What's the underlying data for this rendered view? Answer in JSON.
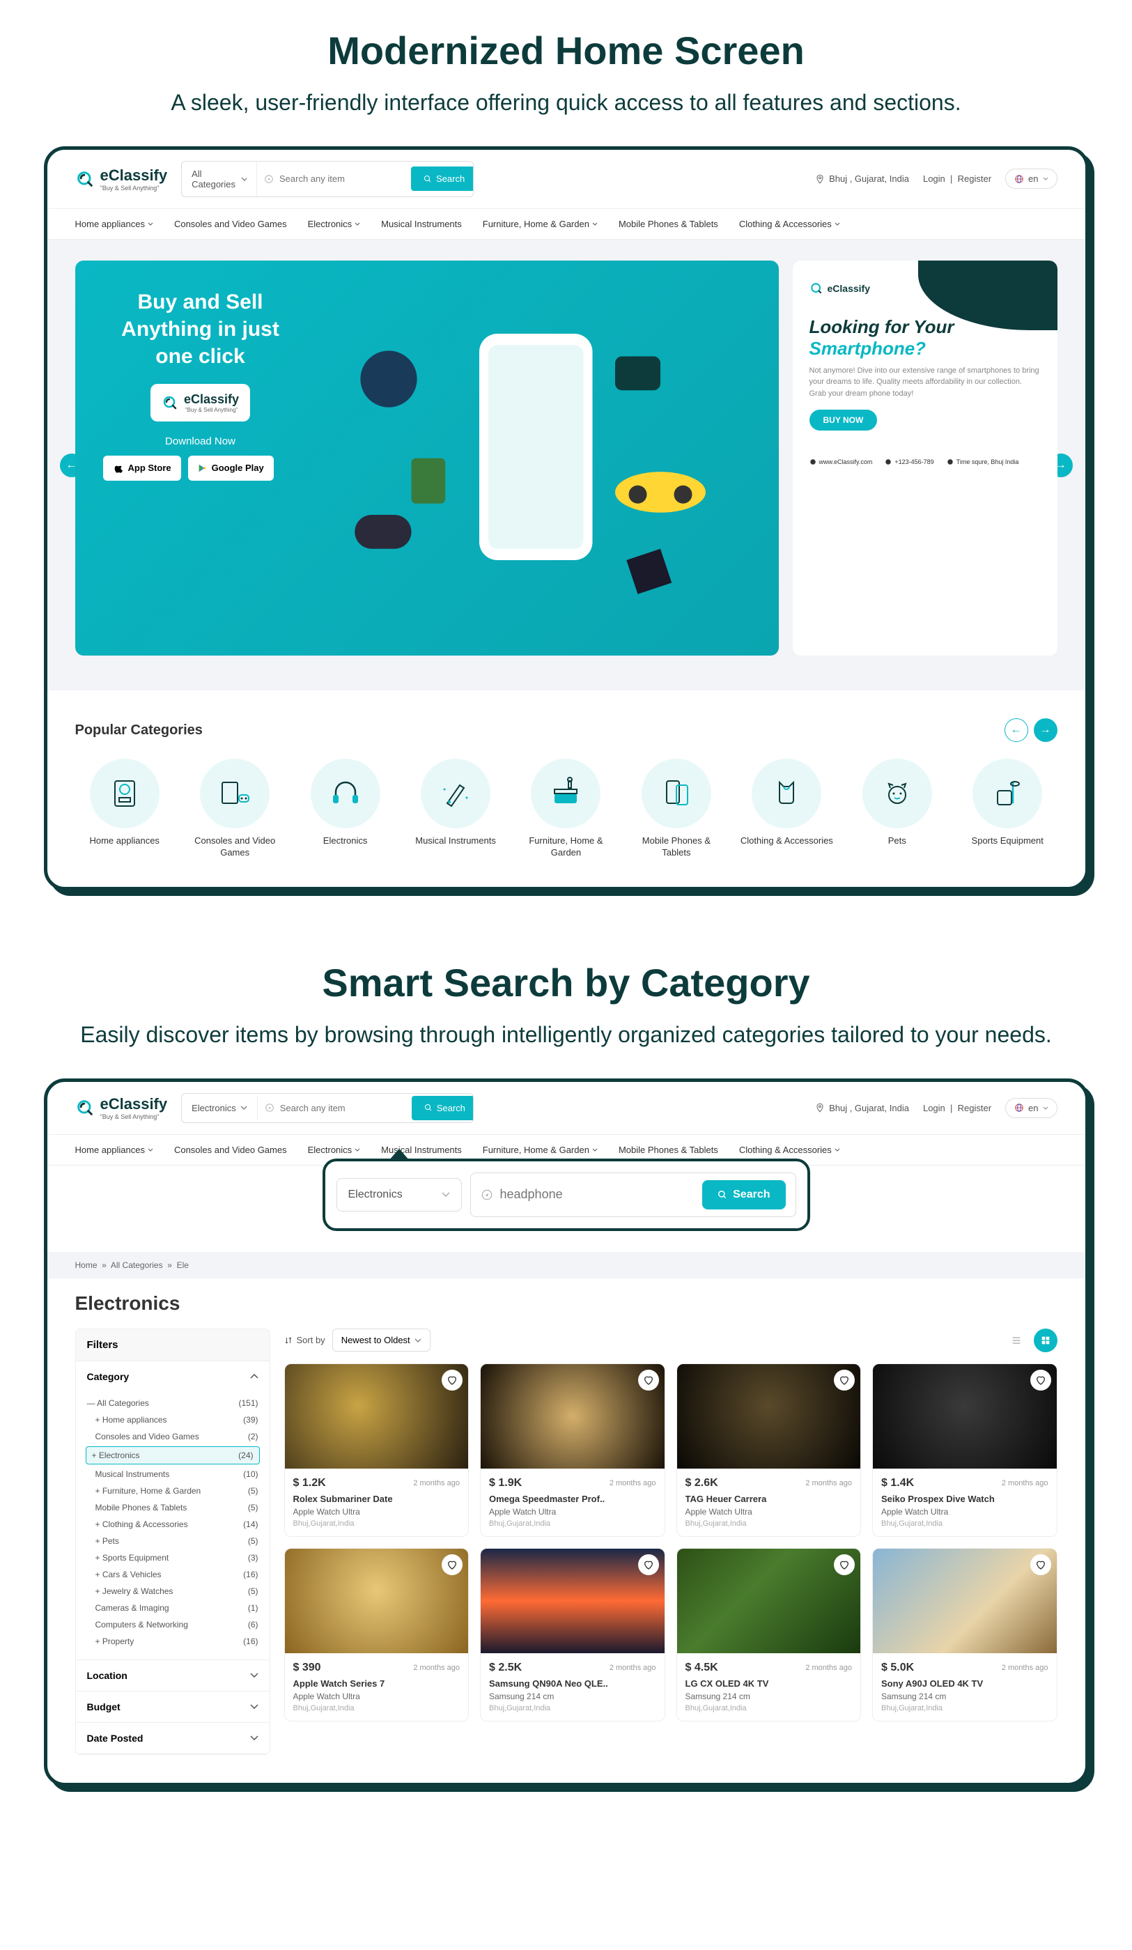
{
  "section1": {
    "title": "Modernized Home Screen",
    "subtitle": "A sleek, user-friendly interface offering quick access to all features and sections."
  },
  "section2": {
    "title": "Smart Search by Category",
    "subtitle": "Easily discover items by browsing through intelligently organized categories tailored to your needs."
  },
  "logo": {
    "name": "eClassify",
    "tagline": "\"Buy & Sell Anything\""
  },
  "topbar": {
    "category_default": "All Categories",
    "category_electronics": "Electronics",
    "search_placeholder": "Search any item",
    "search_btn": "Search",
    "location": "Bhuj , Gujarat, India",
    "login": "Login",
    "register": "Register",
    "lang": "en"
  },
  "nav": [
    {
      "label": "Home appliances",
      "dropdown": true
    },
    {
      "label": "Consoles and Video Games",
      "dropdown": false
    },
    {
      "label": "Electronics",
      "dropdown": true
    },
    {
      "label": "Musical Instruments",
      "dropdown": false
    },
    {
      "label": "Furniture, Home & Garden",
      "dropdown": true
    },
    {
      "label": "Mobile Phones & Tablets",
      "dropdown": false
    },
    {
      "label": "Clothing & Accessories",
      "dropdown": true
    }
  ],
  "hero": {
    "title": "Buy and Sell Anything in just one click",
    "download": "Download Now",
    "app_store": "App Store",
    "google_play": "Google Play",
    "side": {
      "title_line1": "Looking for Your",
      "title_line2": "Smartphone?",
      "desc": "Not anymore! Dive into our extensive range of smartphones to bring your dreams to life. Quality meets affordability in our collection. Grab your dream phone today!",
      "buy": "BUY NOW",
      "web": "www.eClassify.com",
      "phone": "+123-456-789",
      "addr": "Time squre, Bhuj India"
    }
  },
  "popular_categories": {
    "title": "Popular Categories",
    "items": [
      "Home appliances",
      "Consoles and Video Games",
      "Electronics",
      "Musical Instruments",
      "Furniture, Home & Garden",
      "Mobile Phones & Tablets",
      "Clothing & Accessories",
      "Pets",
      "Sports Equipment"
    ]
  },
  "overlay": {
    "category": "Electronics",
    "placeholder": "headphone",
    "search_btn": "Search"
  },
  "breadcrumb": {
    "home": "Home",
    "all": "All Categories",
    "current": "Ele"
  },
  "page_heading": "Electronics",
  "filters": {
    "title": "Filters",
    "category": "Category",
    "location": "Location",
    "budget": "Budget",
    "date_posted": "Date Posted",
    "tree": [
      {
        "label": "All Categories",
        "count": "(151)",
        "level": 0,
        "prefix": "—"
      },
      {
        "label": "Home appliances",
        "count": "(39)",
        "level": 1,
        "prefix": "+"
      },
      {
        "label": "Consoles and Video Games",
        "count": "(2)",
        "level": 1,
        "prefix": ""
      },
      {
        "label": "Electronics",
        "count": "(24)",
        "level": 1,
        "prefix": "+",
        "selected": true
      },
      {
        "label": "Musical Instruments",
        "count": "(10)",
        "level": 1,
        "prefix": ""
      },
      {
        "label": "Furniture, Home & Garden",
        "count": "(5)",
        "level": 1,
        "prefix": "+"
      },
      {
        "label": "Mobile Phones & Tablets",
        "count": "(5)",
        "level": 1,
        "prefix": ""
      },
      {
        "label": "Clothing & Accessories",
        "count": "(14)",
        "level": 1,
        "prefix": "+"
      },
      {
        "label": "Pets",
        "count": "(5)",
        "level": 1,
        "prefix": "+"
      },
      {
        "label": "Sports Equipment",
        "count": "(3)",
        "level": 1,
        "prefix": "+"
      },
      {
        "label": "Cars & Vehicles",
        "count": "(16)",
        "level": 1,
        "prefix": "+"
      },
      {
        "label": "Jewelry & Watches",
        "count": "(5)",
        "level": 1,
        "prefix": "+"
      },
      {
        "label": "Cameras & Imaging",
        "count": "(1)",
        "level": 1,
        "prefix": ""
      },
      {
        "label": "Computers & Networking",
        "count": "(6)",
        "level": 1,
        "prefix": ""
      },
      {
        "label": "Property",
        "count": "(16)",
        "level": 1,
        "prefix": "+"
      }
    ]
  },
  "sort": {
    "label": "Sort by",
    "value": "Newest to Oldest"
  },
  "products": [
    {
      "price": "$ 1.2K",
      "time": "2 months ago",
      "title": "Rolex Submariner Date",
      "sub": "Apple Watch Ultra",
      "loc": "Bhuj,Gujarat,India",
      "bg": "bg-watch"
    },
    {
      "price": "$ 1.9K",
      "time": "2 months ago",
      "title": "Omega Speedmaster Prof..",
      "sub": "Apple Watch Ultra",
      "loc": "Bhuj,Gujarat,India",
      "bg": "bg-watch2"
    },
    {
      "price": "$ 2.6K",
      "time": "2 months ago",
      "title": "TAG Heuer Carrera",
      "sub": "Apple Watch Ultra",
      "loc": "Bhuj,Gujarat,India",
      "bg": "bg-watch3"
    },
    {
      "price": "$ 1.4K",
      "time": "2 months ago",
      "title": "Seiko Prospex Dive Watch",
      "sub": "Apple Watch Ultra",
      "loc": "Bhuj,Gujarat,India",
      "bg": "bg-watch4"
    },
    {
      "price": "$ 390",
      "time": "2 months ago",
      "title": "Apple Watch Series 7",
      "sub": "Apple Watch Ultra",
      "loc": "Bhuj,Gujarat,India",
      "bg": "bg-watch5"
    },
    {
      "price": "$ 2.5K",
      "time": "2 months ago",
      "title": "Samsung QN90A Neo QLE..",
      "sub": "Samsung 214 cm",
      "loc": "Bhuj,Gujarat,India",
      "bg": "bg-tv1"
    },
    {
      "price": "$ 4.5K",
      "time": "2 months ago",
      "title": "LG CX OLED 4K TV",
      "sub": "Samsung 214 cm",
      "loc": "Bhuj,Gujarat,India",
      "bg": "bg-tv2"
    },
    {
      "price": "$ 5.0K",
      "time": "2 months ago",
      "title": "Sony A90J OLED 4K TV",
      "sub": "Samsung 214 cm",
      "loc": "Bhuj,Gujarat,India",
      "bg": "bg-tv3"
    }
  ]
}
